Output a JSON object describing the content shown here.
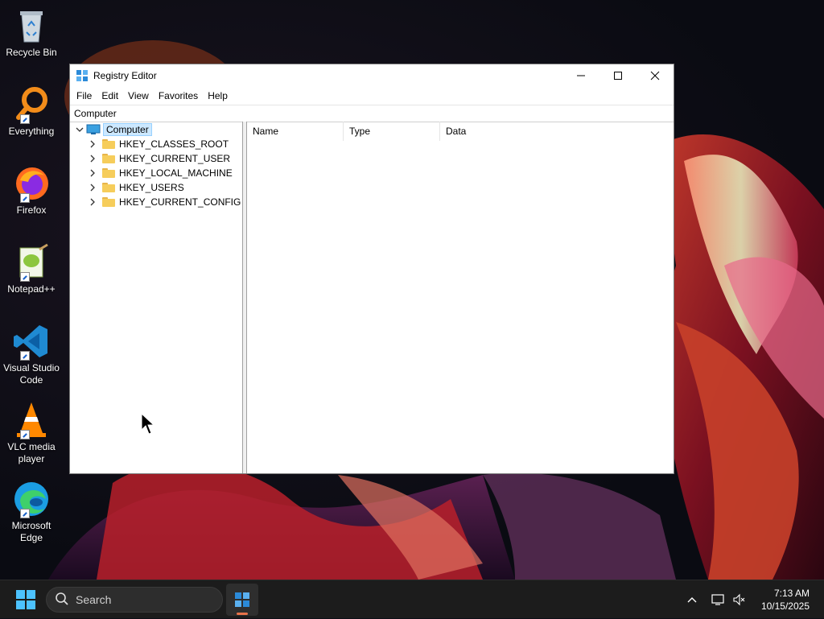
{
  "desktop": {
    "icons": [
      {
        "label": "Recycle Bin"
      },
      {
        "label": "Everything"
      },
      {
        "label": "Firefox"
      },
      {
        "label": "Notepad++"
      },
      {
        "label": "Visual Studio Code"
      },
      {
        "label": "VLC media player"
      },
      {
        "label": "Microsoft Edge"
      }
    ]
  },
  "window": {
    "title": "Registry Editor",
    "icon": "registry-editor-icon",
    "controls": {
      "minimize": "—",
      "maximize": "☐",
      "close": "✕"
    },
    "menu": [
      "File",
      "Edit",
      "View",
      "Favorites",
      "Help"
    ],
    "address": "Computer",
    "tree": {
      "root": "Computer",
      "keys": [
        "HKEY_CLASSES_ROOT",
        "HKEY_CURRENT_USER",
        "HKEY_LOCAL_MACHINE",
        "HKEY_USERS",
        "HKEY_CURRENT_CONFIG"
      ]
    },
    "columns": [
      "Name",
      "Type",
      "Data"
    ]
  },
  "taskbar": {
    "search_placeholder": "Search",
    "time": "7:13 AM",
    "date": "10/15/2025"
  },
  "colors": {
    "selection": "#cce8ff",
    "taskbar": "#1c1c1c",
    "folder": "#f6cd5b"
  }
}
